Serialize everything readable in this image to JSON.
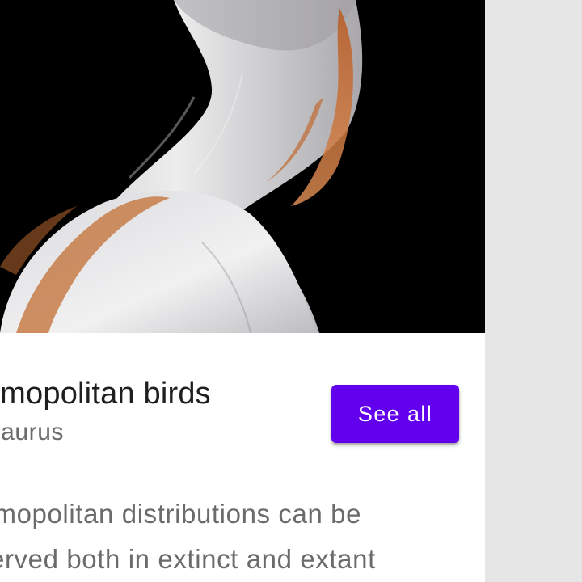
{
  "card": {
    "image_alt": "bird",
    "title": "Cosmopolitan birds",
    "subtitle": "Thesaurus",
    "action_label": "See all",
    "body_lines": [
      "Cosmopolitan distributions can be",
      "observed both in extinct and extant"
    ]
  },
  "colors": {
    "accent": "#6200ee",
    "title_text": "#1f1f1f",
    "secondary_text": "#6b6b6b",
    "background": "#e6e6e6"
  }
}
